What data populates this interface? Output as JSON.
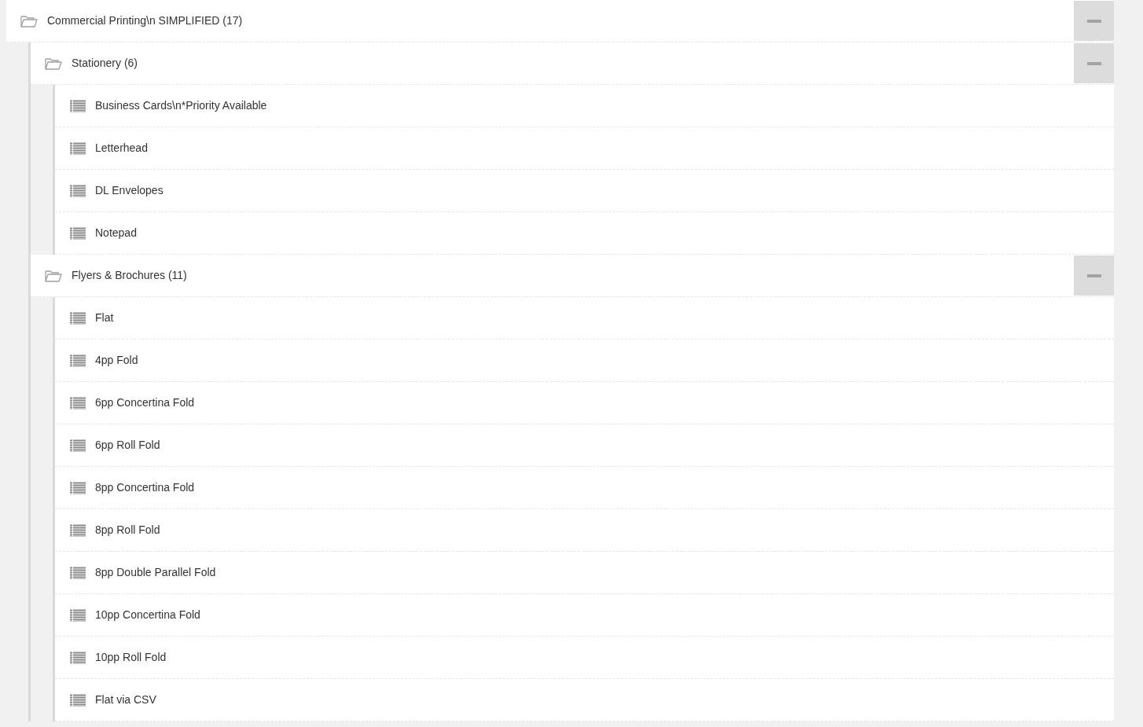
{
  "tree": [
    {
      "kind": "folder",
      "label": "Commercial Printing\\n SIMPLIFIED (17)",
      "expanded": true,
      "children": [
        {
          "kind": "folder",
          "label": "Stationery (6)",
          "expanded": true,
          "children": [
            {
              "kind": "item",
              "label": "Business Cards\\n*Priority Available"
            },
            {
              "kind": "item",
              "label": "Letterhead"
            },
            {
              "kind": "item",
              "label": "DL Envelopes"
            },
            {
              "kind": "item",
              "label": "Notepad"
            }
          ]
        },
        {
          "kind": "folder",
          "label": "Flyers & Brochures (11)",
          "expanded": true,
          "children": [
            {
              "kind": "item",
              "label": "Flat"
            },
            {
              "kind": "item",
              "label": "4pp Fold"
            },
            {
              "kind": "item",
              "label": "6pp Concertina Fold"
            },
            {
              "kind": "item",
              "label": "6pp Roll Fold"
            },
            {
              "kind": "item",
              "label": "8pp Concertina Fold"
            },
            {
              "kind": "item",
              "label": "8pp Roll Fold"
            },
            {
              "kind": "item",
              "label": "8pp Double Parallel Fold"
            },
            {
              "kind": "item",
              "label": "10pp Concertina Fold"
            },
            {
              "kind": "item",
              "label": "10pp Roll Fold"
            },
            {
              "kind": "item",
              "label": "Flat via CSV"
            }
          ]
        }
      ]
    }
  ]
}
